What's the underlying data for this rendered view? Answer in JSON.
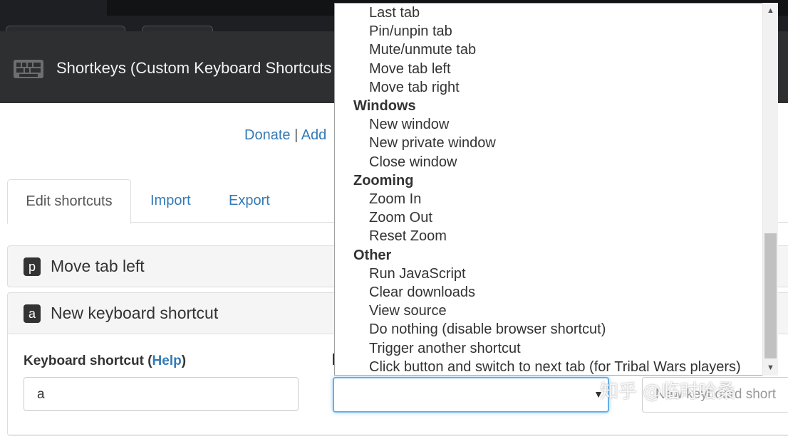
{
  "header": {
    "title": "Shortkeys (Custom Keyboard Shortcuts",
    "brand_icon": "keyboard-icon"
  },
  "links": {
    "donate": "Donate",
    "separator": "|",
    "add": "Add"
  },
  "tabs": [
    {
      "label": "Edit shortcuts",
      "active": true
    },
    {
      "label": "Import",
      "active": false
    },
    {
      "label": "Export",
      "active": false
    }
  ],
  "panels": [
    {
      "key": "p",
      "title": "Move tab left"
    },
    {
      "key": "a",
      "title": "New keyboard shortcut"
    }
  ],
  "form": {
    "shortcut_label": "Keyboard shortcut (",
    "help_link": "Help",
    "shortcut_label_end": ")",
    "shortcut_value": "a",
    "select_value": "",
    "label_placeholder": "New keyboard short"
  },
  "dropdown": {
    "items": [
      {
        "type": "option",
        "label": "Last tab"
      },
      {
        "type": "option",
        "label": "Pin/unpin tab"
      },
      {
        "type": "option",
        "label": "Mute/unmute tab"
      },
      {
        "type": "option",
        "label": "Move tab left"
      },
      {
        "type": "option",
        "label": "Move tab right"
      },
      {
        "type": "group",
        "label": "Windows"
      },
      {
        "type": "option",
        "label": "New window"
      },
      {
        "type": "option",
        "label": "New private window"
      },
      {
        "type": "option",
        "label": "Close window"
      },
      {
        "type": "group",
        "label": "Zooming"
      },
      {
        "type": "option",
        "label": "Zoom In"
      },
      {
        "type": "option",
        "label": "Zoom Out"
      },
      {
        "type": "option",
        "label": "Reset Zoom"
      },
      {
        "type": "group",
        "label": "Other"
      },
      {
        "type": "option",
        "label": "Run JavaScript"
      },
      {
        "type": "option",
        "label": "Clear downloads"
      },
      {
        "type": "option",
        "label": "View source"
      },
      {
        "type": "option",
        "label": "Do nothing (disable browser shortcut)"
      },
      {
        "type": "option",
        "label": "Trigger another shortcut"
      },
      {
        "type": "option",
        "label": "Click button and switch to next tab (for Tribal Wars players)"
      }
    ]
  },
  "watermark": "知乎 @临时哈桑",
  "colors": {
    "link": "#337ab7",
    "navbar": "#2e2f31",
    "focus": "#66afe9"
  }
}
